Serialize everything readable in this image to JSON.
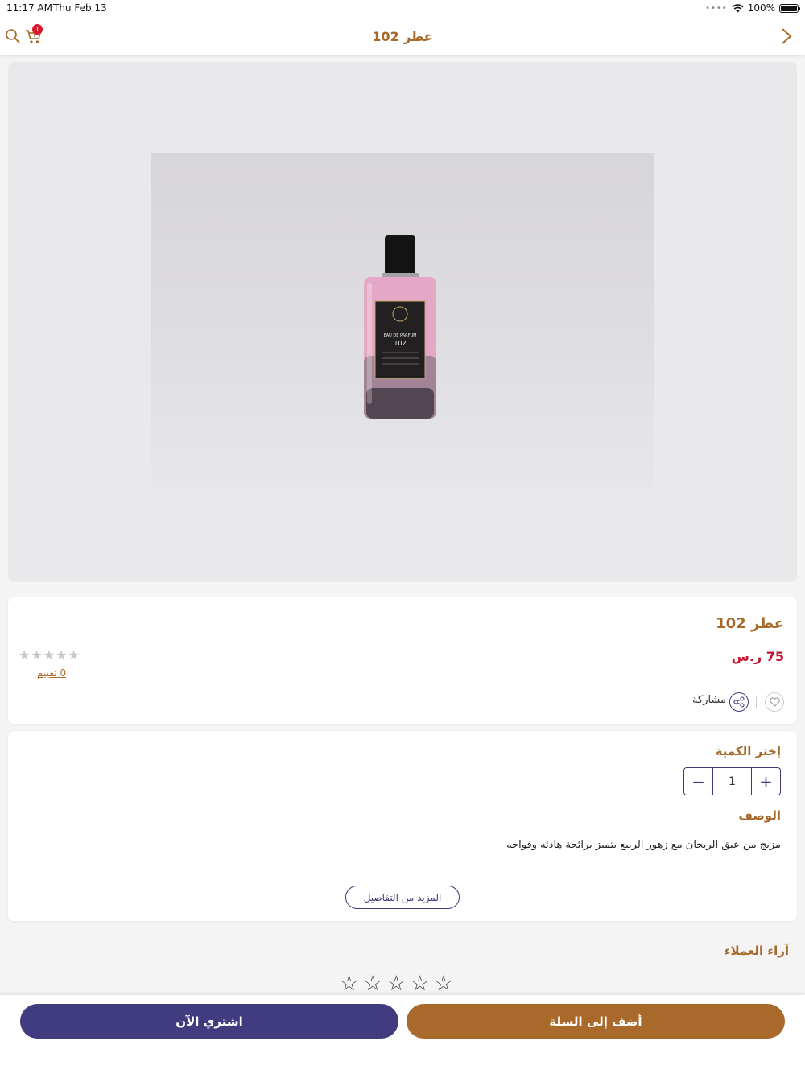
{
  "status_bar": {
    "time": "11:17 AM",
    "date": "Thu Feb 13",
    "battery": "100%"
  },
  "nav": {
    "title": "عطر 102",
    "cart_count": "1"
  },
  "product": {
    "name": "عطر 102",
    "price": "75 ر.س",
    "rating_count": "0 تقييم",
    "share_label": "مشاركة",
    "bottle_label": "EAU DE PARFUM",
    "bottle_number": "102"
  },
  "quantity": {
    "label": "إختر الكمية",
    "value": "1",
    "minus": "−",
    "plus": "+"
  },
  "description": {
    "title": "الوصف",
    "text": "مزيج من عبق الريحان مع زهور الربيع يتميز برائحة هادئه وفواحه",
    "more_label": "المزيد من التفاصيل"
  },
  "reviews": {
    "title": "آراء العملاء"
  },
  "actions": {
    "buy_now": "اشتري الآن",
    "add_to_cart": "أضف إلى السلة"
  },
  "colors": {
    "brand_brown": "#a6692a",
    "brand_purple": "#413b80",
    "price_red": "#c4122f"
  }
}
